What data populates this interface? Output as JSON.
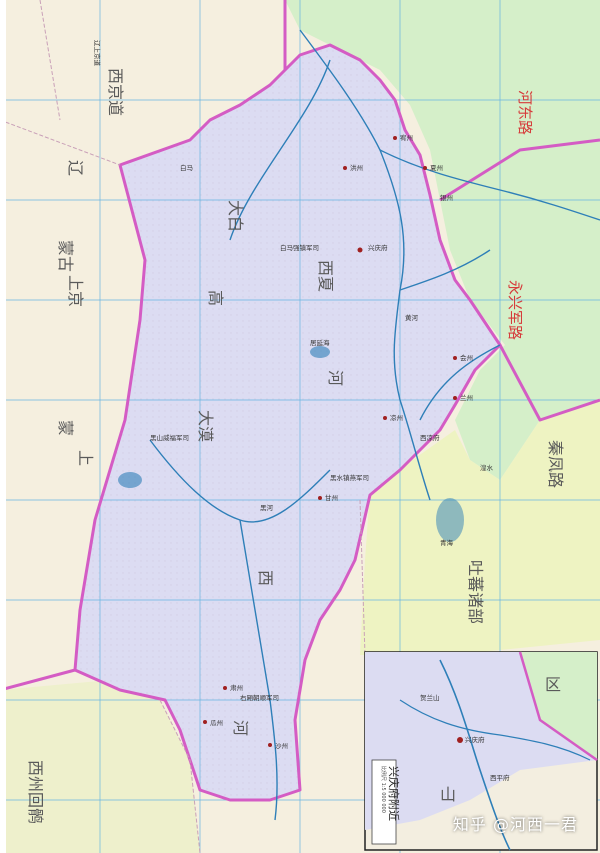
{
  "colors": {
    "xixia": "#dcdcf2",
    "mongol": "#f3eee0",
    "song": "#d5efc9",
    "tubo": "#eef3c2",
    "xinjiang": "#eef0cc",
    "border": "#d45cc4",
    "river": "#2e7fb8",
    "grid": "#67b5e0"
  },
  "labels": {
    "liao_shang_jing_dao": "辽上京道",
    "xi_jing_dao": "西京道",
    "liao": "辽",
    "menggu": "蒙古",
    "shang_jing": "上京",
    "meng": "蒙",
    "shang": "上",
    "liao2": "辽",
    "hedong_lu": "河东路",
    "yongxing_jun_lu": "永兴军路",
    "qinfeng_lu": "秦凤路",
    "tubo_bu": "吐蕃诸部",
    "xixia_dabai": "大白",
    "xixia_gao": "高",
    "xixia_guo": "西夏",
    "xixia_he": "河",
    "xi_cha": "西",
    "da_mo": "大漠",
    "hexi": "河",
    "xi_zhou": "西州回鹘",
    "shazhou": "沙州",
    "gua_zhou": "瓜州",
    "su_zhou": "肃州",
    "gan_zhou": "甘州",
    "liang_zhou": "凉州",
    "hong_zhou": "洪州",
    "you_zhou": "宥州",
    "xia_zhou": "夏州",
    "yin_zhou": "银州",
    "xingqing": "兴庆府",
    "xiliang": "西凉府",
    "huizhou": "会州",
    "lanzhou": "兰州",
    "bai_ma_qiang": "白马强镇军司",
    "hei_shan": "黑山威福军司",
    "you_zhou_jia": "右厢朝顺军司",
    "heishui": "黑水镇燕军司",
    "bai_ma": "白马",
    "black_river": "黑河",
    "juyan": "居延海",
    "qinghai": "青海",
    "huangshui": "湟水",
    "huanghe": "黄河",
    "inset_title": "兴庆府附近",
    "inset_region_a": "贺兰山",
    "inset_region_b": "西平府",
    "inset_scale": "比例尺 1:5 000 000",
    "inset_label_bottom": "山",
    "inset_label_d": "区"
  },
  "watermark": "知乎 @河西一君"
}
